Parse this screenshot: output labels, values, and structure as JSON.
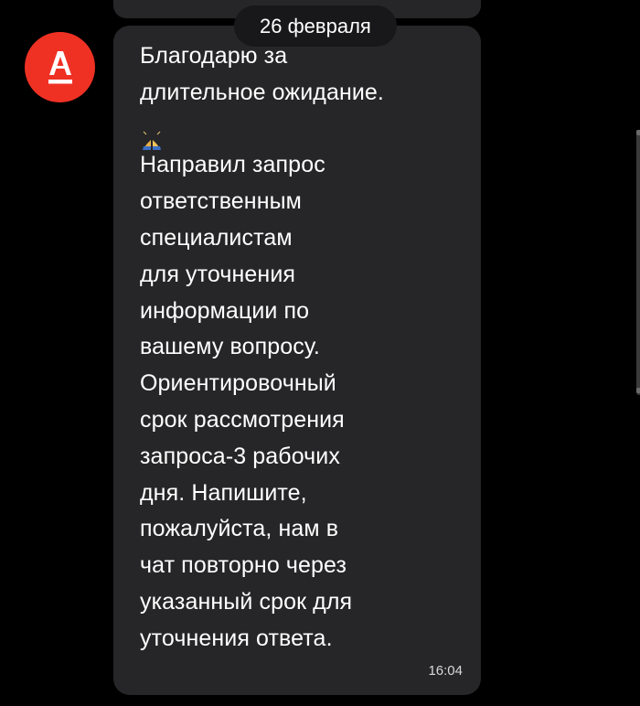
{
  "chat": {
    "date_chip": "26 февраля",
    "message": {
      "line_1": "Благодарю за\nдлительное ожидание.",
      "line_2": "Направил запрос\nответственным\nспециалистам\nдля уточнения\nинформации по\nвашему вопросу.\nОриентировочный\nсрок рассмотрения\nзапроса-3 рабочих\nдня. Напишите,\nпожалуйста, нам в\nчат повторно через\nуказанный срок для\nуточнения ответа.",
      "time": "16:04",
      "emoji": "folded-hands-emoji"
    },
    "sender": {
      "avatar_letter": "А",
      "avatar_color": "#ef3124"
    }
  }
}
